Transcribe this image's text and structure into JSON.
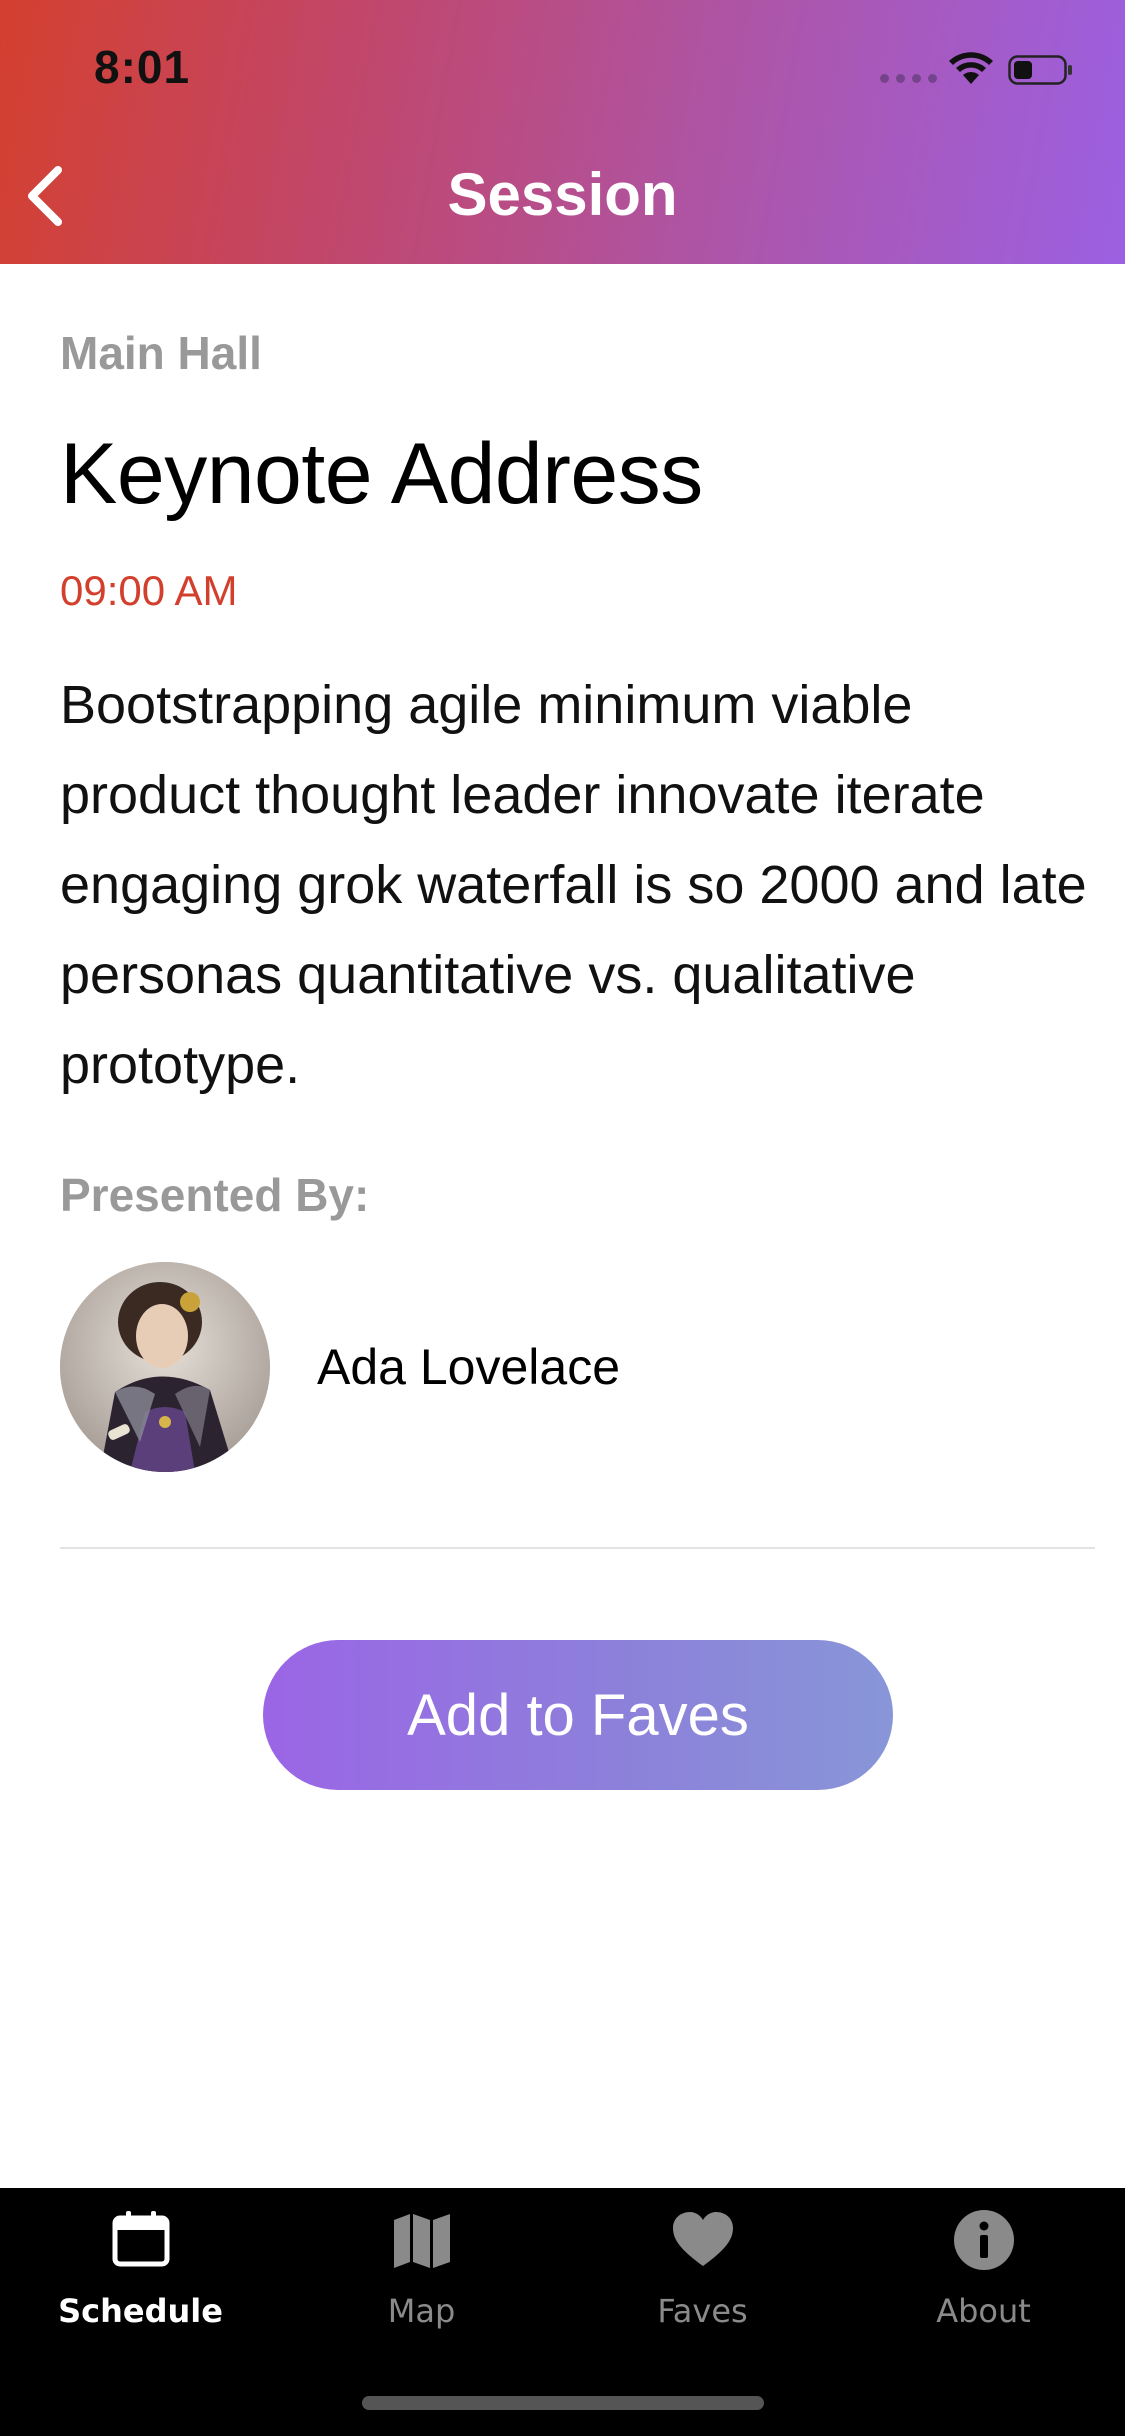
{
  "status_bar": {
    "time": "8:01"
  },
  "header": {
    "title": "Session",
    "back_icon": "chevron-left-icon",
    "gradient_colors": [
      "#d4402f",
      "#9c60e2"
    ]
  },
  "session": {
    "location": "Main Hall",
    "title": "Keynote Address",
    "time": "09:00 AM",
    "description": "Bootstrapping agile minimum viable product thought leader innovate iterate engaging grok waterfall is so 2000 and late personas quantitative vs. qualitative prototype.",
    "presented_by_label": "Presented By:",
    "speaker": {
      "name": "Ada Lovelace"
    }
  },
  "actions": {
    "add_to_faves_label": "Add to Faves"
  },
  "tabbar": {
    "tabs": [
      {
        "label": "Schedule",
        "icon": "calendar-icon",
        "active": true
      },
      {
        "label": "Map",
        "icon": "map-icon",
        "active": false
      },
      {
        "label": "Faves",
        "icon": "heart-icon",
        "active": false
      },
      {
        "label": "About",
        "icon": "info-icon",
        "active": false
      }
    ]
  },
  "colors": {
    "accent_time": "#d2402d",
    "muted_label": "#999999",
    "button_start": "#9b65e6",
    "button_end": "#8896d8"
  }
}
